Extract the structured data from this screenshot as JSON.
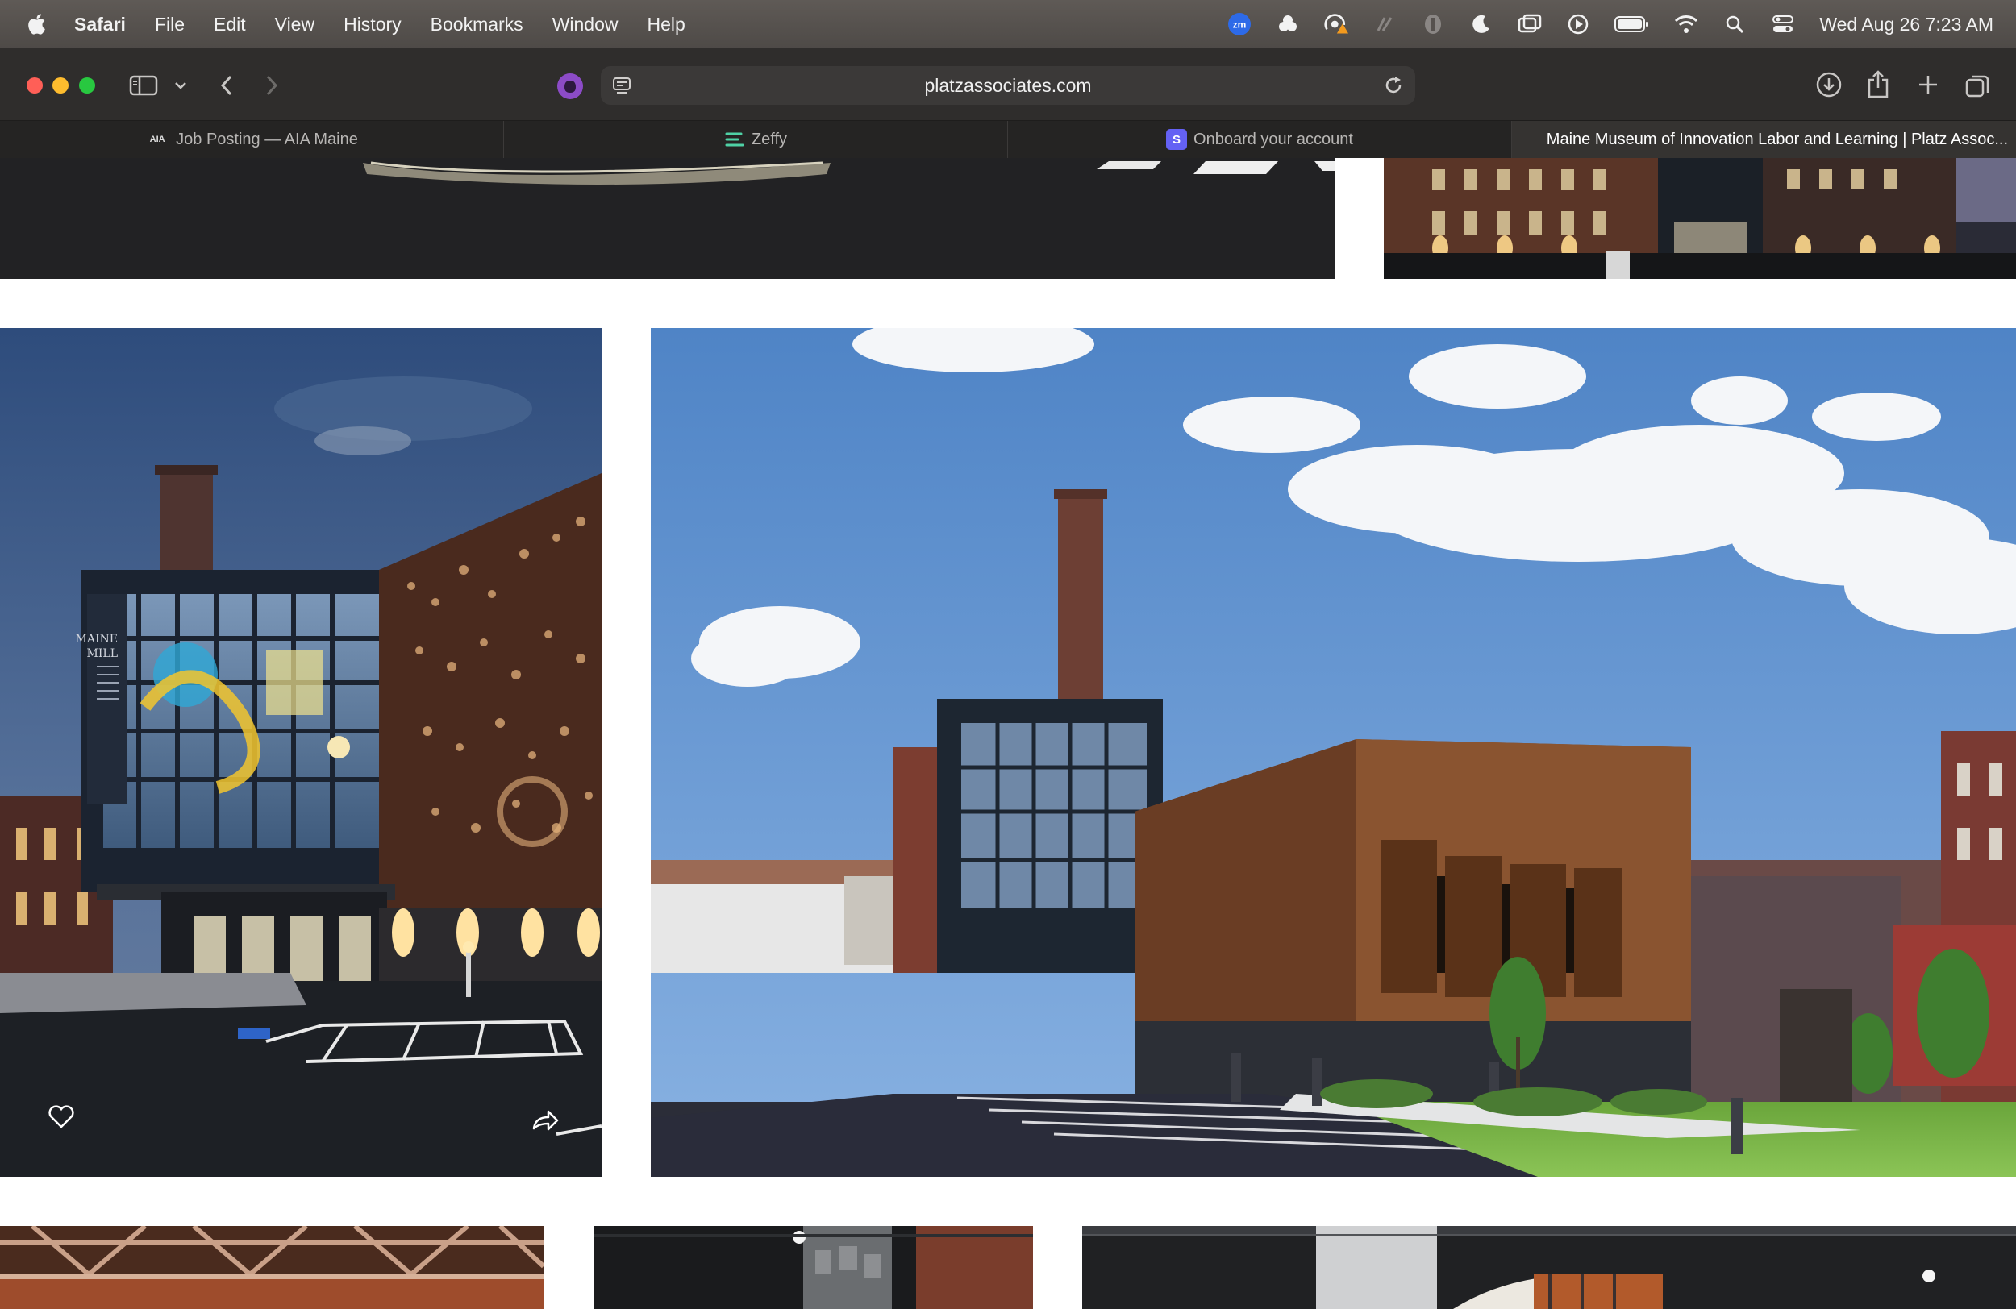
{
  "menubar": {
    "app_name": "Safari",
    "items": [
      "File",
      "Edit",
      "View",
      "History",
      "Bookmarks",
      "Window",
      "Help"
    ],
    "clock": "Wed Aug 26  7:23 AM",
    "zoom_badge": "zm"
  },
  "toolbar": {
    "url": "platzassociates.com"
  },
  "tabs": [
    {
      "label": "Job Posting — AIA Maine",
      "favicon": "AIA"
    },
    {
      "label": "Zeffy",
      "favicon": "zeffy"
    },
    {
      "label": "Onboard your account",
      "favicon": "S"
    },
    {
      "label": "Maine Museum of Innovation Labor and Learning | Platz Assoc...",
      "favicon": ""
    }
  ],
  "gallery": {
    "sign_text": [
      "MAINE",
      "MILL"
    ],
    "photos": [
      "top-left-parking-photo",
      "top-right-night-building-photo",
      "night-entrance-photo",
      "daytime-exterior-photo",
      "bottom-left-interior-photo",
      "bottom-middle-interior-photo",
      "bottom-right-interior-photo"
    ]
  },
  "colors": {
    "menubar": "#56514e",
    "toolbar": "#2f2d2c",
    "tabbar": "#252423",
    "active_tab": "#353331"
  }
}
